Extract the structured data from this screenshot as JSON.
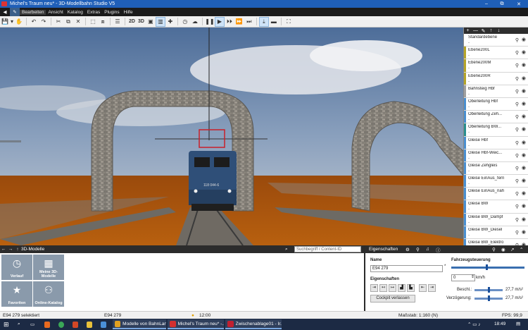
{
  "window": {
    "title": "Michel's Traum neu* - 3D-Modellbahn Studio V5",
    "controls": [
      "–",
      "⧉",
      "✕"
    ]
  },
  "menu": [
    "Bearbeiten",
    "Ansicht",
    "Katalog",
    "Extras",
    "Plugins",
    "Hilfe"
  ],
  "toolbar": {
    "view_2d": "2D",
    "view_3d": "3D"
  },
  "scene": {
    "locomotive_number": "118 044-6"
  },
  "layers": {
    "header_icons": [
      "+",
      "—",
      "✎",
      "↑",
      "↓"
    ],
    "items": [
      {
        "name": "Standardebene",
        "sub": "-",
        "color": "#ffffff"
      },
      {
        "name": "Ebene200L",
        "sub": "-",
        "color": "#b5a52a"
      },
      {
        "name": "Ebene200M",
        "sub": "-",
        "color": "#b5a52a"
      },
      {
        "name": "Ebene200R",
        "sub": "-",
        "color": "#b5a52a"
      },
      {
        "name": "Bahnsteig Hbf",
        "sub": "-",
        "color": "#a0a0a0"
      },
      {
        "name": "Oberleitung Hbf",
        "sub": "-",
        "color": "#4a8fd0"
      },
      {
        "name": "Oberleitung Zeh...",
        "sub": "-",
        "color": "#4a8fd0"
      },
      {
        "name": "Oberleitung BW...",
        "sub": "-",
        "color": "#2a8f8f"
      },
      {
        "name": "Gleise Hbf",
        "sub": "-",
        "color": "#4a8fd0"
      },
      {
        "name": "Gleise Hbf-Weic...",
        "sub": "-",
        "color": "#4a8fd0"
      },
      {
        "name": "Gleise Zehgleis",
        "sub": "-",
        "color": "#4a8fd0"
      },
      {
        "name": "Gleise EinAus_fern",
        "sub": "-",
        "color": "#4a8fd0"
      },
      {
        "name": "Gleise EinAus_nah",
        "sub": "-",
        "color": "#4a8fd0"
      },
      {
        "name": "Gleise BW",
        "sub": "-",
        "color": "#4a8fd0"
      },
      {
        "name": "Gleise BW_Dampf",
        "sub": "-",
        "color": "#4a8fd0"
      },
      {
        "name": "Gleise BW_Diesel",
        "sub": "-",
        "color": "#4a8fd0"
      },
      {
        "name": "Gleise BW_Elektro",
        "sub": "-",
        "color": "#4a8fd0"
      }
    ]
  },
  "models_panel": {
    "title": "3D-Modelle",
    "search_placeholder": "Suchbegriff / Content-ID",
    "tiles": [
      {
        "label": "Verlauf",
        "icon": "clock-icon"
      },
      {
        "label": "Meine 3D-Modelle",
        "icon": "grid-icon"
      },
      {
        "label": "Favoriten",
        "icon": "star-icon"
      },
      {
        "label": "Online-Katalog",
        "icon": "people-icon"
      }
    ]
  },
  "properties": {
    "title": "Eigenschaften",
    "name_label": "Name",
    "name_value": "E94 279",
    "props_label": "Eigenschaften",
    "cockpit_button": "Cockpit verlassen",
    "control_label": "Fahrzeugsteuerung",
    "speed_value": "0",
    "speed_unit": "km/h",
    "accel_label": "Beschl.:",
    "accel_value": "27,7 m/s²",
    "decel_label": "Verzögerung:",
    "decel_value": "27,7 m/s²"
  },
  "status": {
    "selected": "E94 279 selektiert",
    "object": "E94 279",
    "time": "12:00",
    "scale": "Maßstab: 1:160 (N)",
    "fps": "FPS: 99,9"
  },
  "taskbar": {
    "items": [
      {
        "label": "Modelle von BahnLan...",
        "color": "#e0a020"
      },
      {
        "label": "Michel's Traum neu* -...",
        "color": "#d33030"
      },
      {
        "label": "Zwischenablage01 - Ir...",
        "color": "#c02030"
      }
    ],
    "clock": "18:49"
  },
  "colors": {
    "accent": "#1f5fb8",
    "ground": "#a8520f",
    "sky_top": "#4f6f9a"
  }
}
